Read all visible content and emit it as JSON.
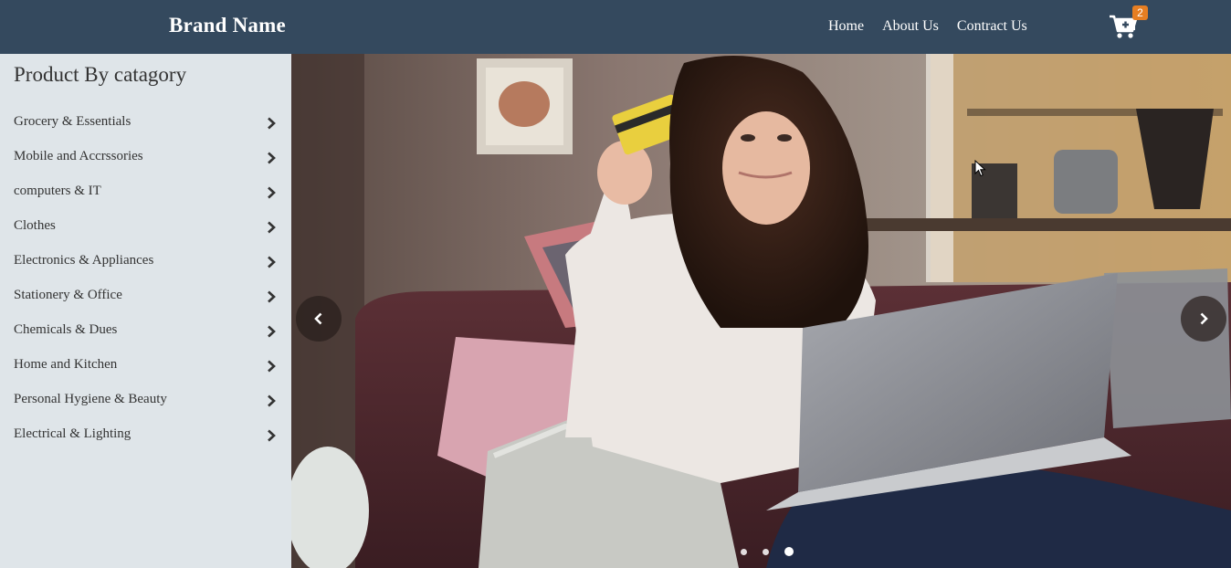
{
  "navbar": {
    "brand": "Brand Name",
    "links": [
      {
        "label": "Home"
      },
      {
        "label": "About Us"
      },
      {
        "label": "Contract Us"
      }
    ],
    "cart": {
      "icon": "cart-plus-icon",
      "badge_count": "2",
      "badge_color": "#e67e22"
    },
    "background": "#34495e"
  },
  "sidebar": {
    "title": "Product By catagory",
    "background": "#dfe5e9",
    "categories": [
      {
        "label": "Grocery & Essentials"
      },
      {
        "label": "Mobile and Accrssories"
      },
      {
        "label": "computers & IT"
      },
      {
        "label": "Clothes"
      },
      {
        "label": "Electronics & Appliances"
      },
      {
        "label": "Stationery & Office"
      },
      {
        "label": "Chemicals & Dues"
      },
      {
        "label": "Home and Kitchen"
      },
      {
        "label": "Personal Hygiene & Beauty"
      },
      {
        "label": "Electrical & Lighting"
      }
    ],
    "chevron_icon": "chevron-right-icon"
  },
  "carousel": {
    "slide_count": 3,
    "active_index": 2,
    "prev_icon": "chevron-left-icon",
    "next_icon": "chevron-right-icon"
  }
}
